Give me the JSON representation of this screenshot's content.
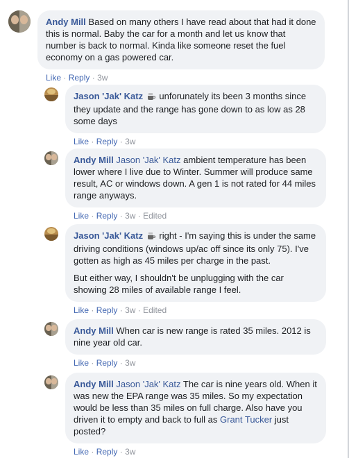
{
  "comments": [
    {
      "author": "Andy Mill",
      "mention": "",
      "paragraphs": [
        "Based on many others I have read about that had it done this is normal. Baby the car for a month and let us know that number is back to normal. Kinda like someone reset the fuel economy on a gas powered car."
      ],
      "time": "3w",
      "edited": ""
    },
    {
      "author": "Jason 'Jak' Katz",
      "mention": "",
      "paragraphs": [
        "unforunately its been 3 months since they update and the range has gone down to as low as 28 some days"
      ],
      "time": "3w",
      "edited": ""
    },
    {
      "author": "Andy Mill",
      "mention": "Jason 'Jak' Katz",
      "paragraphs": [
        "ambient temperature has been lower where I live due to Winter. Summer will produce same result, AC or windows down. A gen 1 is not rated for 44 miles range anyways."
      ],
      "time": "3w",
      "edited": "Edited"
    },
    {
      "author": "Jason 'Jak' Katz",
      "mention": "",
      "paragraphs": [
        "right - I'm saying this is under the same driving conditions (windows up/ac off since its only 75). I've gotten as high as 45 miles per charge in the past.",
        "But either way, I shouldn't be unplugging with the car showing 28 miles of available range I feel."
      ],
      "time": "3w",
      "edited": "Edited"
    },
    {
      "author": "Andy Mill",
      "mention": "",
      "paragraphs": [
        "When car is new range is rated 35 miles. 2012 is nine year old car."
      ],
      "time": "3w",
      "edited": ""
    },
    {
      "author": "Andy Mill",
      "mention": "Jason 'Jak' Katz",
      "paragraphs": [
        "The car is nine years old. When it was new the EPA range was 35 miles. So my expectation would be less than 35 miles on full charge. Also have you driven it to empty and back to full as"
      ],
      "tail_mention": "Grant Tucker",
      "tail_text": "just posted?",
      "time": "3w",
      "edited": ""
    }
  ],
  "actions": {
    "like": "Like",
    "reply": "Reply",
    "dot": "·"
  },
  "icons": {
    "badge": "coffee-cup-icon"
  },
  "colors": {
    "link": "#385898",
    "bubble": "#f0f2f5",
    "meta": "#90949c"
  }
}
